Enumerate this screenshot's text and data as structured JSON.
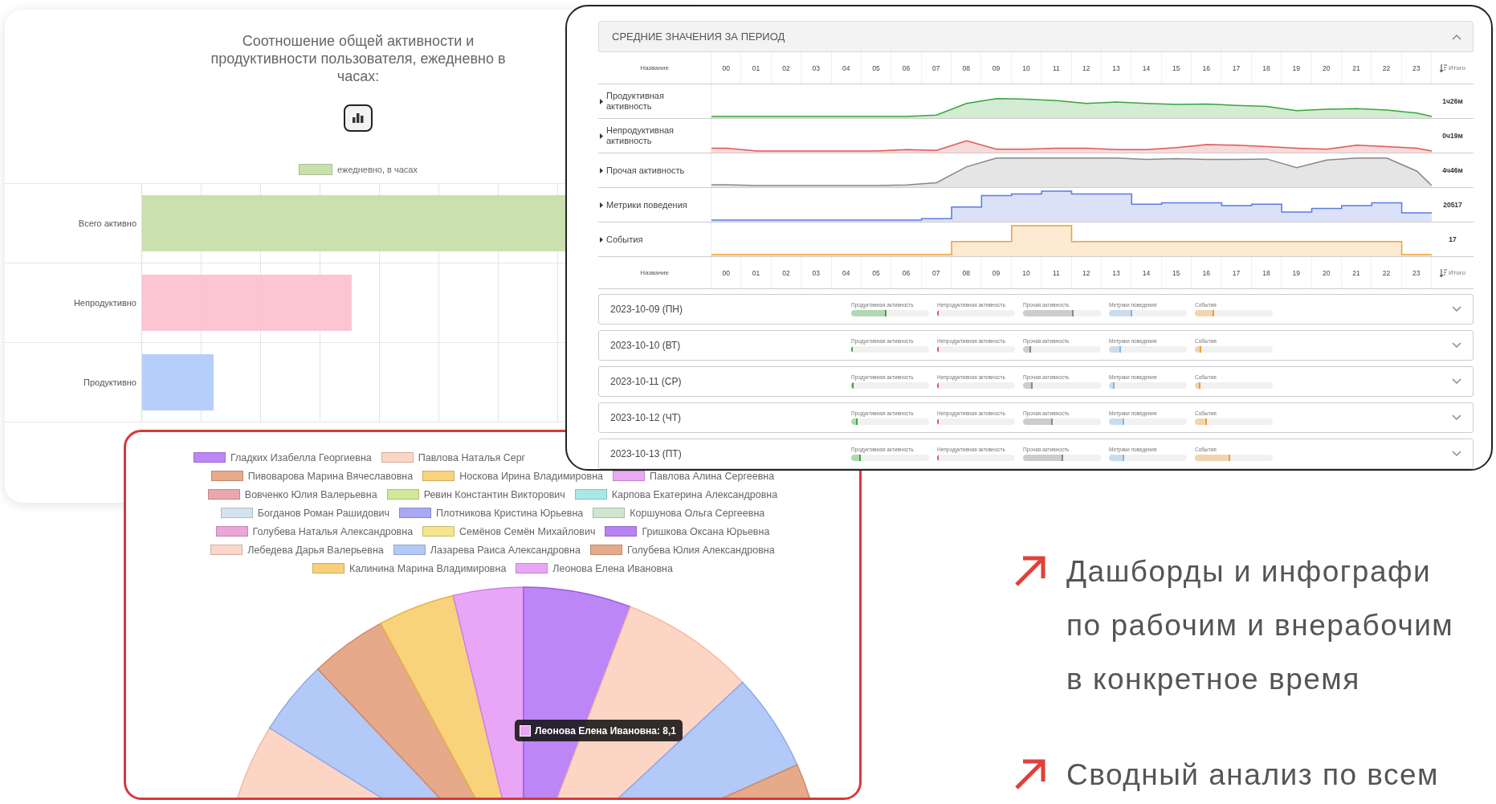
{
  "activity_chart": {
    "title": "Соотношение общей активности и продуктивности пользователя, ежедневно в часах:",
    "legend": "ежедневно, в часах",
    "bars": [
      {
        "label": "Всего активно",
        "color": "#c8e0ab"
      },
      {
        "label": "Непродуктивно",
        "color": "#fbc4d0"
      },
      {
        "label": "Продуктивно",
        "color": "#b3cdfa"
      }
    ]
  },
  "distribution_chart": {
    "legend_rows": [
      [
        {
          "name": "Гладких Изабелла Георгиевна",
          "color": "#bd86f6"
        },
        {
          "name": "Павлова Наталья Серг",
          "color": "#fdd5c5"
        }
      ],
      [
        {
          "name": "Пивоварова Марина Вячеславовна",
          "color": "#e6a98a"
        },
        {
          "name": "Носкова Ирина Владимировна",
          "color": "#f9d27c"
        },
        {
          "name": "Павлова Алина Сергеевна",
          "color": "#e8aaf5"
        }
      ],
      [
        {
          "name": "Вовченко Юлия Валерьевна",
          "color": "#eba7ae"
        },
        {
          "name": "Ревин Константин Викторович",
          "color": "#d2e89a"
        },
        {
          "name": "Карпова Екатерина Александровна",
          "color": "#a9e8e6"
        }
      ],
      [
        {
          "name": "Богданов Роман Рашидович",
          "color": "#d3e3f0"
        },
        {
          "name": "Плотникова Кристина Юрьевна",
          "color": "#a8a8f5"
        },
        {
          "name": "Коршунова Ольга Сергеевна",
          "color": "#cfe6d3"
        }
      ],
      [
        {
          "name": "Голубева Наталья Александровна",
          "color": "#eaa6d8"
        },
        {
          "name": "Семёнов Семён Михайлович",
          "color": "#f6e58a"
        },
        {
          "name": "Гришкова Оксана Юрьевна",
          "color": "#b882f5"
        }
      ],
      [
        {
          "name": "Лебедева Дарья Валерьевна",
          "color": "#fcd6c8"
        },
        {
          "name": "Лазарева Раиса Александровна",
          "color": "#b3c9f7"
        },
        {
          "name": "Голубева Юлия Александровна",
          "color": "#e6a98a"
        }
      ],
      [
        {
          "name": "Калинина Марина Владимировна",
          "color": "#f9cf78"
        },
        {
          "name": "Леонова Елена Ивановна",
          "color": "#e9a6f6"
        }
      ]
    ],
    "tooltip": {
      "label": "Леонова Елена Ивановна: 8,1",
      "color": "#e9a6f6"
    }
  },
  "averages_panel": {
    "title": "СРЕДНИЕ ЗНАЧЕНИЯ ЗА ПЕРИОД",
    "expanded": true,
    "header_rows": [
      {
        "name_label": "Название",
        "hours": [
          "00",
          "01",
          "02",
          "03",
          "04",
          "05",
          "06",
          "07",
          "08",
          "09",
          "10",
          "11",
          "12",
          "13",
          "14",
          "15",
          "16",
          "17",
          "18",
          "19",
          "20",
          "21",
          "22",
          "23"
        ],
        "total_label": "Итого"
      },
      {
        "name_label": "Название",
        "hours": [
          "00",
          "01",
          "02",
          "03",
          "04",
          "05",
          "06",
          "07",
          "08",
          "09",
          "10",
          "11",
          "12",
          "13",
          "14",
          "15",
          "16",
          "17",
          "18",
          "19",
          "20",
          "21",
          "22",
          "23"
        ],
        "total_label": "Итого"
      }
    ],
    "rows": [
      {
        "name": "Продуктивная активность",
        "total": "1ч26м",
        "color": "#3aa53a",
        "kind": "smooth"
      },
      {
        "name": "Непродуктивная активность",
        "total": "0ч19м",
        "color": "#e05555",
        "kind": "smooth"
      },
      {
        "name": "Прочая активность",
        "total": "4ч46м",
        "color": "#888888",
        "kind": "smooth"
      },
      {
        "name": "Метрики поведения",
        "total": "20517",
        "color": "#5b7be0",
        "kind": "step"
      },
      {
        "name": "События",
        "total": "17",
        "color": "#f0a030",
        "kind": "step"
      }
    ],
    "days": [
      {
        "date": "2023-10-09 (ПН)",
        "expanded": false,
        "metrics": [
          {
            "label": "Продуктивная активность",
            "level": 0.45,
            "color": "#3aa53a"
          },
          {
            "label": "Непродуктивная активность",
            "level": 0.02,
            "color": "#e05555"
          },
          {
            "label": "Прочая активность",
            "level": 0.65,
            "color": "#888888"
          },
          {
            "label": "Метрики поведения",
            "level": 0.3,
            "color": "#7fb7e6"
          },
          {
            "label": "События",
            "level": 0.25,
            "color": "#f0a030"
          }
        ]
      },
      {
        "date": "2023-10-10 (ВТ)",
        "expanded": false,
        "metrics": [
          {
            "label": "Продуктивная активность",
            "level": 0.02,
            "color": "#3aa53a"
          },
          {
            "label": "Непродуктивная активность",
            "level": 0.02,
            "color": "#e05555"
          },
          {
            "label": "Прочая активность",
            "level": 0.1,
            "color": "#888888"
          },
          {
            "label": "Метрики поведения",
            "level": 0.15,
            "color": "#7fb7e6"
          },
          {
            "label": "События",
            "level": 0.08,
            "color": "#f0a030"
          }
        ]
      },
      {
        "date": "2023-10-11 (СР)",
        "expanded": false,
        "metrics": [
          {
            "label": "Продуктивная активность",
            "level": 0.03,
            "color": "#3aa53a"
          },
          {
            "label": "Непродуктивная активность",
            "level": 0.02,
            "color": "#e05555"
          },
          {
            "label": "Прочая активность",
            "level": 0.12,
            "color": "#888888"
          },
          {
            "label": "Метрики поведения",
            "level": 0.07,
            "color": "#7fb7e6"
          },
          {
            "label": "События",
            "level": 0.07,
            "color": "#f0a030"
          }
        ]
      },
      {
        "date": "2023-10-12 (ЧТ)",
        "expanded": false,
        "metrics": [
          {
            "label": "Продуктивная активность",
            "level": 0.08,
            "color": "#3aa53a"
          },
          {
            "label": "Непродуктивная активность",
            "level": 0.02,
            "color": "#e05555"
          },
          {
            "label": "Прочая активность",
            "level": 0.38,
            "color": "#888888"
          },
          {
            "label": "Метрики поведения",
            "level": 0.2,
            "color": "#7fb7e6"
          },
          {
            "label": "События",
            "level": 0.15,
            "color": "#f0a030"
          }
        ]
      },
      {
        "date": "2023-10-13 (ПТ)",
        "expanded": false,
        "metrics": [
          {
            "label": "Продуктивная активность",
            "level": 0.12,
            "color": "#3aa53a"
          },
          {
            "label": "Непродуктивная активность",
            "level": 0.02,
            "color": "#e05555"
          },
          {
            "label": "Прочая активность",
            "level": 0.52,
            "color": "#888888"
          },
          {
            "label": "Метрики поведения",
            "level": 0.2,
            "color": "#7fb7e6"
          },
          {
            "label": "События",
            "level": 0.45,
            "color": "#f0a030"
          }
        ]
      }
    ]
  },
  "features": [
    {
      "lines": [
        "Дашборды и инфографи",
        "по рабочим и внерабочим",
        "в конкретное время"
      ]
    },
    {
      "lines": [
        "Сводный анализ по всем"
      ]
    }
  ]
}
